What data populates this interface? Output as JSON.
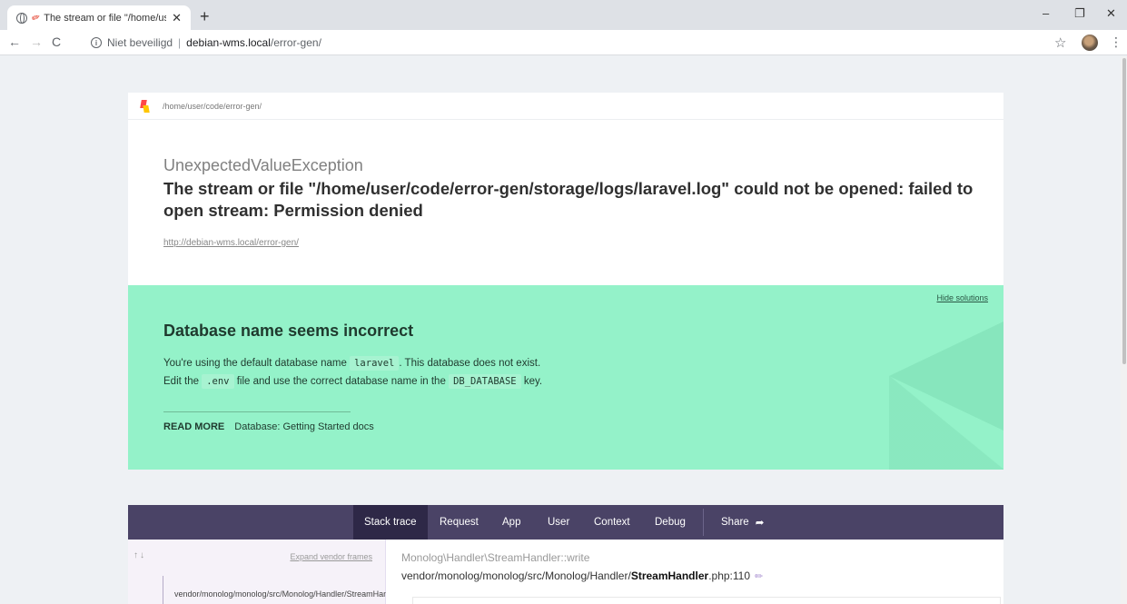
{
  "browser": {
    "tab_title": "The stream or file \"/home/us",
    "new_tab_symbol": "+",
    "window_controls": {
      "minimize": "–",
      "restore": "❐",
      "close": "✕"
    },
    "security_label": "Niet beveiligd",
    "separator": "|",
    "url_host": "debian-wms.local",
    "url_path": "/error-gen/"
  },
  "error": {
    "path": "/home/user/code/error-gen/",
    "exception_class": "UnexpectedValueException",
    "message": "The stream or file \"/home/user/code/error-gen/storage/logs/laravel.log\" could not be opened: failed to open stream: Permission denied",
    "url": "http://debian-wms.local/error-gen/"
  },
  "solution": {
    "hide_label": "Hide solutions",
    "title": "Database name seems incorrect",
    "line1_pre": "You're using the default database name",
    "line1_code": "laravel",
    "line1_post": ". This database does not exist.",
    "line2_pre": "Edit the",
    "line2_code1": ".env",
    "line2_mid": "file and use the correct database name in the",
    "line2_code2": "DB_DATABASE",
    "line2_post": "key.",
    "read_more_label": "READ MORE",
    "read_more_link": "Database: Getting Started docs"
  },
  "stack": {
    "tabs": [
      "Stack trace",
      "Request",
      "App",
      "User",
      "Context",
      "Debug"
    ],
    "share_label": "Share",
    "arrows": "↑↓",
    "expand_label": "Expand vendor frames",
    "frame_text": "vendor/monolog/monolog/src/Monolog/Handler/StreamHandler.php",
    "frame_class": "Monolog\\Handler\\StreamHandler::write",
    "file_prefix": "vendor/monolog/monolog/src/Monolog/Handler/",
    "file_name": "StreamHandler",
    "file_suffix": ".php:110"
  }
}
